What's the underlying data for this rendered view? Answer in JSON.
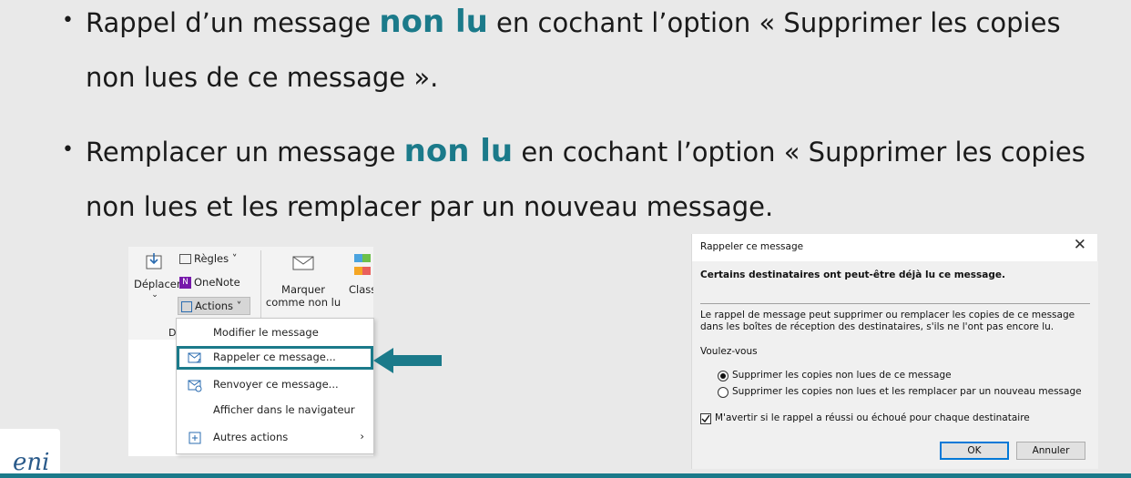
{
  "slide": {
    "bullet1": {
      "before": "Rappel d’un message ",
      "emphasis": "non lu",
      "after": " en cochant l’option « Supprimer les copies",
      "line2": "non lues de ce message »."
    },
    "bullet2": {
      "before": "Remplacer un message ",
      "emphasis": "non lu",
      "after": " en cochant l’option « Supprimer les copies",
      "line2": "non lues et les remplacer par un nouveau message."
    },
    "bullet_char": "•",
    "accent_color": "#1b7a8a"
  },
  "ribbon": {
    "move_label": "Déplacer",
    "rules_label": "Règles",
    "onenote_label": "OneNote",
    "actions_label": "Actions",
    "mark_unread_line1": "Marquer",
    "mark_unread_line2": "comme non lu",
    "classify_label": "Class",
    "group_letter": "D"
  },
  "actions_menu": {
    "items": [
      {
        "label": "Modifier le message",
        "icon": "none"
      },
      {
        "label": "Rappeler ce message...",
        "icon": "recall-message-icon"
      },
      {
        "label": "Renvoyer ce message...",
        "icon": "resend-message-icon"
      },
      {
        "label": "Afficher dans le navigateur",
        "icon": "none"
      },
      {
        "label": "Autres actions",
        "icon": "other-actions-icon",
        "submenu": true
      }
    ]
  },
  "dialog": {
    "title": "Rappeler ce message",
    "headline": "Certains destinataires ont peut-être déjà lu ce message.",
    "description_line1": "Le rappel de message peut supprimer ou remplacer les copies de ce message",
    "description_line2": "dans les boîtes de réception des destinataires, s'ils ne l'ont pas encore lu.",
    "question": "Voulez-vous",
    "option_delete": "Supprimer les copies non lues de ce message",
    "option_replace": "Supprimer les copies non lues et les remplacer par un nouveau message",
    "selected_option": "option_delete",
    "notify_label": "M'avertir si le rappel a réussi ou échoué pour chaque destinataire",
    "notify_checked": true,
    "ok_label": "OK",
    "cancel_label": "Annuler"
  },
  "logo": {
    "text": "eni"
  }
}
